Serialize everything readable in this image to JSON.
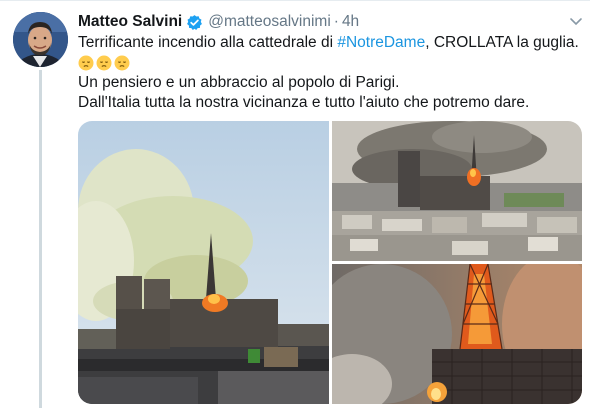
{
  "tweet": {
    "author_name": "Matteo Salvini",
    "handle": "@matteosalvinimi",
    "separator": "·",
    "time": "4h",
    "text_line1_before": "Terrificante incendio alla cattedrale di ",
    "hashtag": "#NotreDame",
    "text_line1_after": ", CROLLATA la guglia.",
    "emoji_icons": [
      "pensive-face-icon",
      "pensive-face-icon",
      "pensive-face-icon"
    ],
    "text_line3": "Un pensiero e un abbraccio al popolo di Parigi.",
    "text_line4": "Dall'Italia tutta la nostra vicinanza e tutto l'aiuto che potremo dare."
  },
  "colors": {
    "link": "#1b95e0",
    "muted": "#657786",
    "text": "#14171a",
    "verified": "#1da1f2",
    "thread_line": "#cfd9de"
  },
  "media": {
    "images": [
      "notre-dame-smoke-photo",
      "paris-aerial-fire-photo",
      "spire-flames-photo"
    ]
  }
}
